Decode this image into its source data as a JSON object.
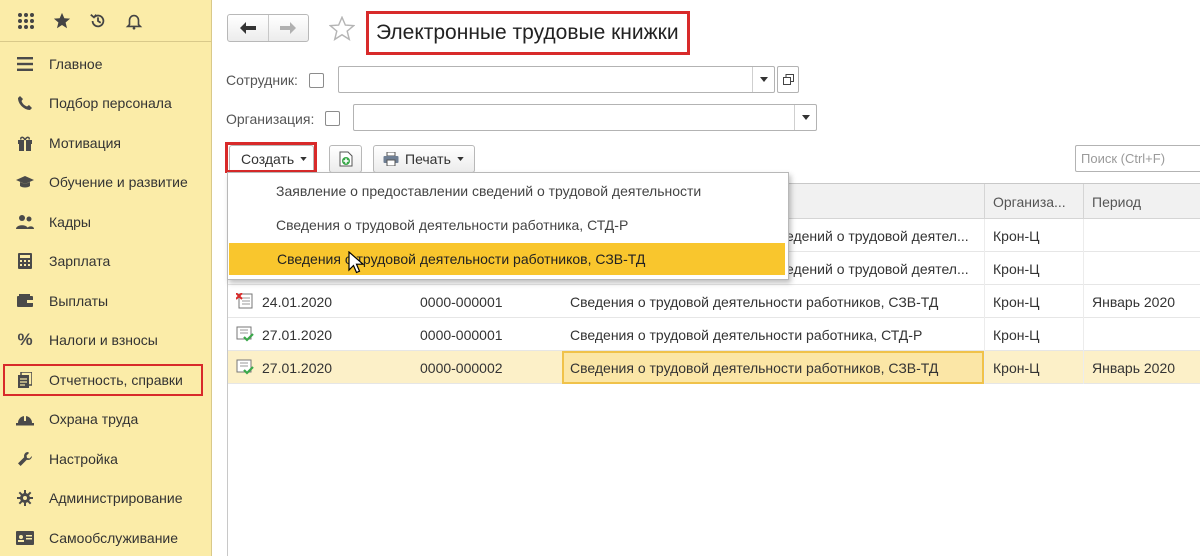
{
  "sidebar": {
    "items": [
      {
        "label": "Главное",
        "icon": "list-icon"
      },
      {
        "label": "Подбор персонала",
        "icon": "phone-icon"
      },
      {
        "label": "Мотивация",
        "icon": "gift-icon"
      },
      {
        "label": "Обучение и развитие",
        "icon": "graduation-cap-icon"
      },
      {
        "label": "Кадры",
        "icon": "people-icon"
      },
      {
        "label": "Зарплата",
        "icon": "calculator-icon"
      },
      {
        "label": "Выплаты",
        "icon": "wallet-icon"
      },
      {
        "label": "Налоги и взносы",
        "icon": "percent-icon"
      },
      {
        "label": "Отчетность, справки",
        "icon": "documents-icon"
      },
      {
        "label": "Охрана труда",
        "icon": "helmet-icon"
      },
      {
        "label": "Настройка",
        "icon": "wrench-icon"
      },
      {
        "label": "Администрирование",
        "icon": "gear-icon"
      },
      {
        "label": "Самообслуживание",
        "icon": "id-card-icon"
      }
    ]
  },
  "header": {
    "title": "Электронные трудовые книжки"
  },
  "filters": {
    "employee_label": "Сотрудник:",
    "employee_value": "",
    "organization_label": "Организация:",
    "organization_value": ""
  },
  "toolbar": {
    "create_label": "Создать",
    "print_label": "Печать",
    "search_placeholder": "Поиск (Ctrl+F)"
  },
  "table": {
    "columns": [
      "Организа...",
      "Период"
    ],
    "rows": [
      {
        "date": "",
        "number": "",
        "name": "едений о трудовой деятел...",
        "org": "Крон-Ц",
        "period": ""
      },
      {
        "date": "",
        "number": "",
        "name": "едений о трудовой деятел...",
        "org": "Крон-Ц",
        "period": ""
      },
      {
        "date": "24.01.2020",
        "number": "0000-000001",
        "name": "Сведения о трудовой деятельности работников, СЗВ-ТД",
        "org": "Крон-Ц",
        "period": "Январь 2020"
      },
      {
        "date": "27.01.2020",
        "number": "0000-000001",
        "name": "Сведения о трудовой деятельности работника, СТД-Р",
        "org": "Крон-Ц",
        "period": ""
      },
      {
        "date": "27.01.2020",
        "number": "0000-000002",
        "name": "Сведения о трудовой деятельности работников, СЗВ-ТД",
        "org": "Крон-Ц",
        "period": "Январь 2020"
      }
    ]
  },
  "create_menu": {
    "items": [
      "Заявление о предоставлении сведений о трудовой деятельности",
      "Сведения о трудовой деятельности работника, СТД-Р",
      "Сведения о трудовой деятельности работников, СЗВ-ТД"
    ],
    "active_index": 2
  },
  "colors": {
    "sidebar_bg": "#fbeca8",
    "highlight_red": "#d82a2a",
    "menu_active": "#f9c62d",
    "selected_row": "#fcf0c8"
  }
}
